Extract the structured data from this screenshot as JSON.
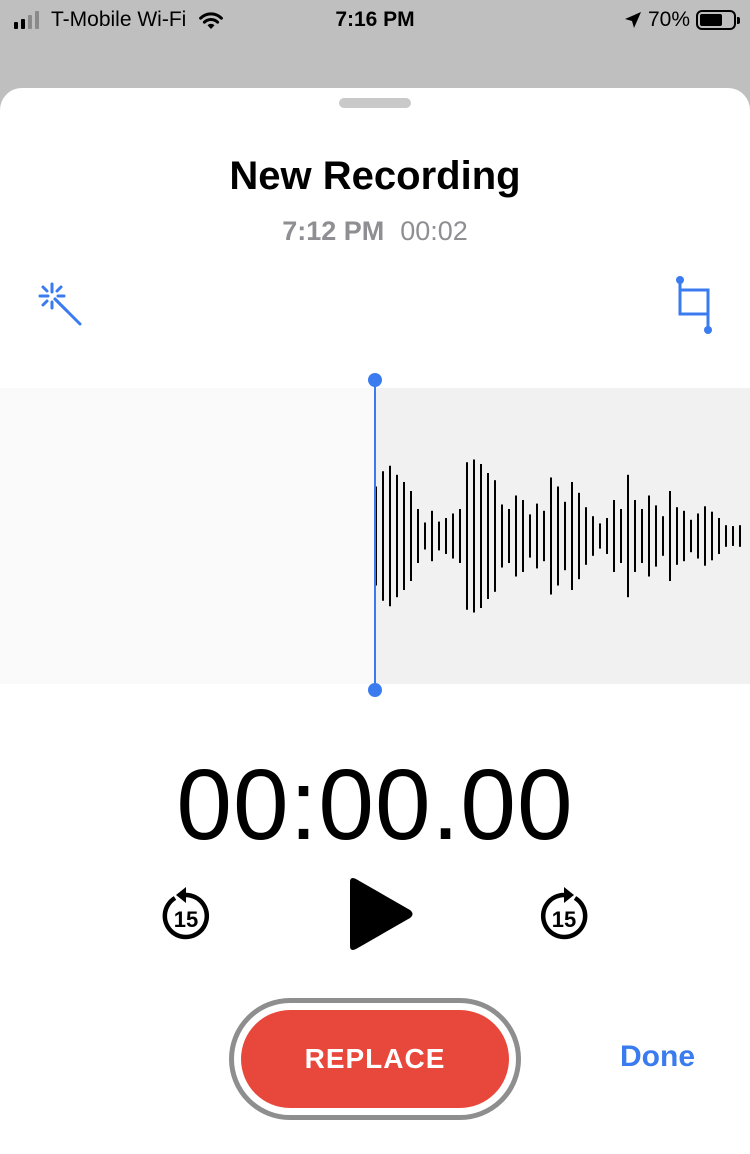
{
  "status_bar": {
    "carrier": "T-Mobile Wi-Fi",
    "time": "7:16 PM",
    "battery": "70%",
    "battery_level": 0.7,
    "icons": [
      "signal-icon",
      "wifi-icon",
      "location-arrow-icon",
      "battery-icon"
    ]
  },
  "recording": {
    "title": "New Recording",
    "time": "7:12 PM",
    "duration": "00:02"
  },
  "toolbar": {
    "enhance_icon": "magic-wand-icon",
    "trim_icon": "crop-trim-icon"
  },
  "waveform": {
    "amplitudes": [
      0.55,
      0.72,
      0.78,
      0.68,
      0.6,
      0.5,
      0.3,
      0.15,
      0.28,
      0.16,
      0.2,
      0.25,
      0.3,
      0.82,
      0.85,
      0.8,
      0.7,
      0.62,
      0.35,
      0.3,
      0.45,
      0.4,
      0.24,
      0.36,
      0.28,
      0.65,
      0.55,
      0.38,
      0.6,
      0.48,
      0.32,
      0.22,
      0.14,
      0.2,
      0.4,
      0.3,
      0.68,
      0.4,
      0.3,
      0.45,
      0.34,
      0.22,
      0.5,
      0.32,
      0.28,
      0.18,
      0.25,
      0.33,
      0.27,
      0.2,
      0.12,
      0.11,
      0.12
    ],
    "playhead_color": "#3a7bef"
  },
  "playback": {
    "timer": "00:00.00",
    "skip_back_seconds": "15",
    "skip_forward_seconds": "15"
  },
  "actions": {
    "replace_label": "REPLACE",
    "done_label": "Done"
  },
  "colors": {
    "accent": "#3a7bef",
    "record": "#e8483b"
  }
}
